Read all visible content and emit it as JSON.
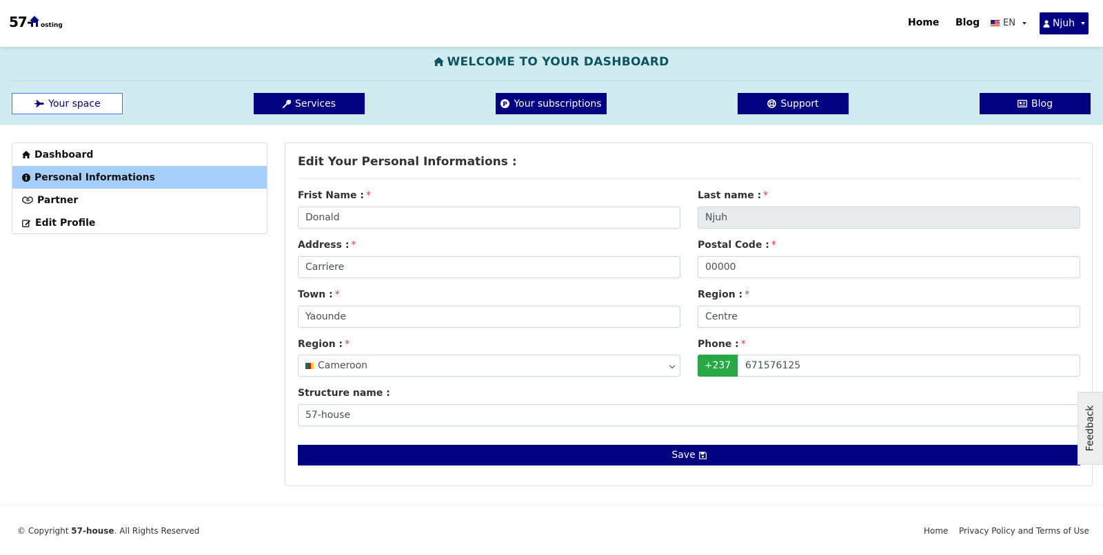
{
  "navbar": {
    "logo_number": "57-",
    "logo_word": "osting",
    "links": {
      "home": "Home",
      "blog": "Blog"
    },
    "language": "EN",
    "user": "Njuh"
  },
  "welcome": {
    "title": "WELCOME TO YOUR DASHBOARD",
    "tabs": {
      "space": "Your space",
      "services": "Services",
      "subscriptions": "Your subscriptions",
      "support": "Support",
      "blog": "Blog"
    }
  },
  "sidebar": {
    "items": [
      "Dashboard",
      "Personal Informations",
      "Partner",
      "Edit Profile"
    ]
  },
  "form": {
    "title": "Edit Your Personal Informations :",
    "first_name": {
      "label": "Frist Name :",
      "value": "Donald"
    },
    "last_name": {
      "label": "Last name :",
      "value": "Njuh"
    },
    "address": {
      "label": "Address :",
      "value": "Carriere"
    },
    "postal_code": {
      "label": "Postal Code :",
      "value": "00000"
    },
    "town": {
      "label": "Town :",
      "value": "Yaounde"
    },
    "region": {
      "label": "Region :",
      "value": "Centre"
    },
    "country": {
      "label": "Region :",
      "value": "Cameroon"
    },
    "phone": {
      "label": "Phone :",
      "prefix": "+237",
      "value": "671576125"
    },
    "structure": {
      "label": "Structure name :",
      "value": "57-house"
    },
    "required_mark": "*",
    "save": "Save"
  },
  "feedback": "Feedback",
  "footer": {
    "copyright_prefix": "© Copyright ",
    "brand": "57-house",
    "copyright_suffix": ". All Rights Reserved",
    "home": "Home",
    "privacy": "Privacy Policy and Terms of Use"
  },
  "colors": {
    "primary": "#000080",
    "success": "#28a745",
    "info_bg": "#d1ecf1",
    "active_item": "#a6d0fb"
  }
}
